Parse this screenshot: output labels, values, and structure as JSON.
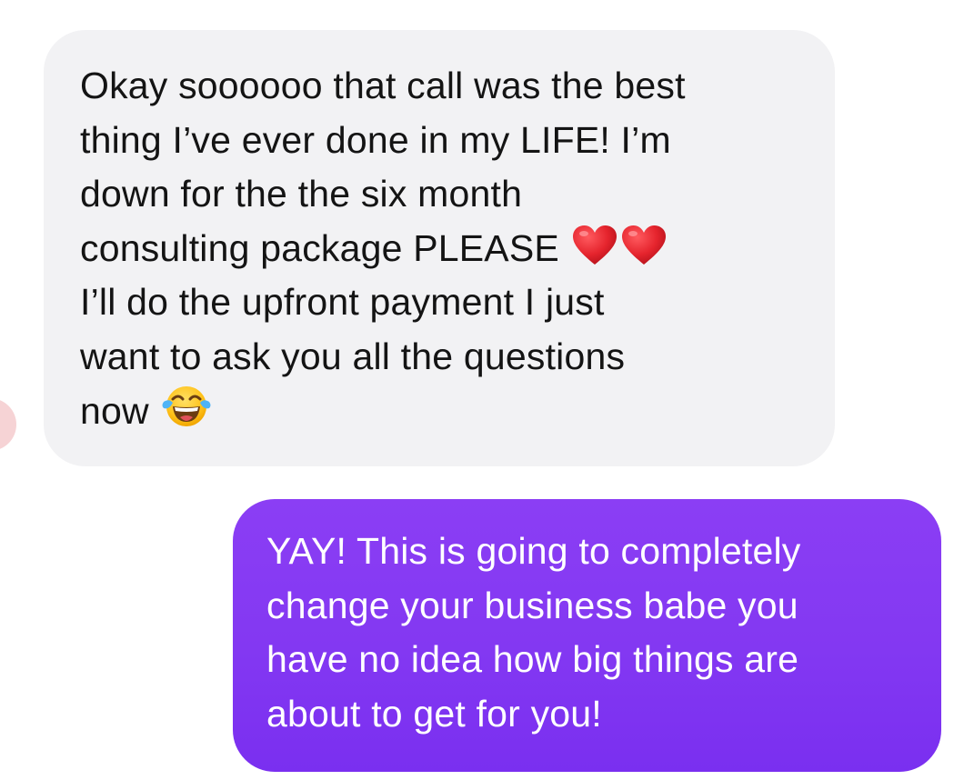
{
  "conversation": {
    "incoming": {
      "lines": [
        "Okay soooooo that call was the best",
        "thing I’ve ever done in my LIFE! I’m",
        "down for the the six month",
        "consulting package PLEASE",
        "I’ll do the upfront payment I just",
        "want to ask you all the questions",
        "now"
      ],
      "emoji": [
        "heart-emoji",
        "heart-emoji",
        "tears-of-joy-emoji"
      ]
    },
    "outgoing": {
      "lines": [
        "YAY! This is going to completely",
        "change your business babe you",
        "have no idea how big things are",
        "about to get for you!"
      ]
    }
  },
  "colors": {
    "incoming_bubble": "#f2f2f4",
    "incoming_text": "#141414",
    "outgoing_bubble": "#8338f2",
    "outgoing_text": "#ffffff",
    "heart": "#e5242d",
    "avatar_hint": "#f6d3d5"
  }
}
